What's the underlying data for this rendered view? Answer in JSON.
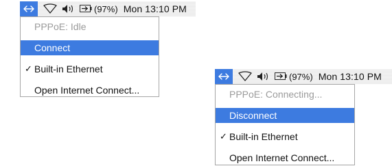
{
  "menus": [
    {
      "menubar": {
        "network_icon": "network-arrows-icon",
        "airport_icon": "airport-wifi-icon",
        "volume_icon": "speaker-volume-icon",
        "battery_icon": "battery-icon",
        "battery_pct": "(97%)",
        "clock": "Mon 13:10 PM"
      },
      "items": {
        "status": "PPPoE: Idle",
        "action": "Connect",
        "check_mark": "✓",
        "ethernet": "Built-in Ethernet",
        "open_app": "Open Internet Connect..."
      }
    },
    {
      "menubar": {
        "network_icon": "network-arrows-icon",
        "airport_icon": "airport-wifi-icon",
        "volume_icon": "speaker-volume-icon",
        "battery_icon": "battery-icon",
        "battery_pct": "(97%)",
        "clock": "Mon 13:10 PM"
      },
      "items": {
        "status": "PPPoE: Connecting...",
        "action": "Disconnect",
        "check_mark": "✓",
        "ethernet": "Built-in Ethernet",
        "open_app": "Open Internet Connect..."
      }
    }
  ],
  "colors": {
    "highlight": "#3d7be0",
    "disabled_text": "#9a9a9a"
  }
}
